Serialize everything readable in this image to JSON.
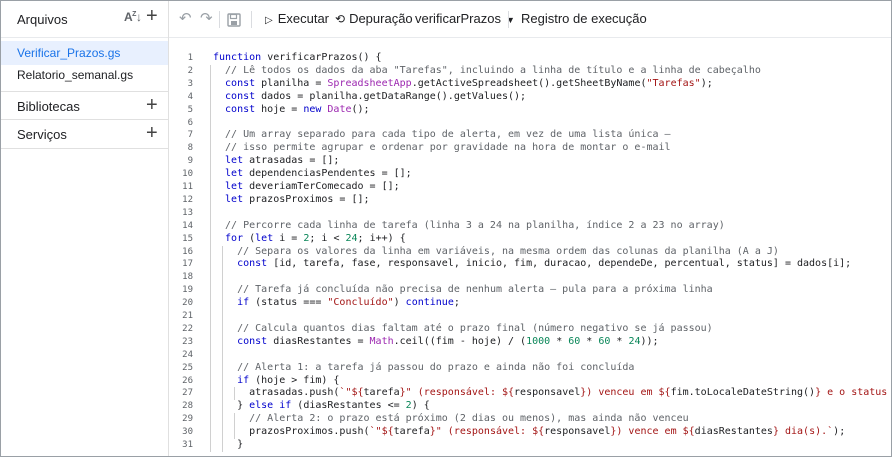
{
  "sidebar": {
    "title": "Arquivos",
    "sort_icon": "az-sort-icon",
    "files": [
      "Verificar_Prazos.gs",
      "Relatorio_semanal.gs"
    ],
    "active_file": "Verificar_Prazos.gs",
    "sections": [
      "Bibliotecas",
      "Serviços"
    ]
  },
  "toolbar": {
    "run_label": "Executar",
    "debug_label": "Depuração",
    "function_select": "verificarPrazos",
    "log_label": "Registro de execução"
  },
  "colors": {
    "keyword": "#0000cc",
    "comment": "#5f6368",
    "string": "#a31515",
    "function": "#9c27b0",
    "number": "#098658",
    "active_file_bg": "#e8f0fe",
    "active_file_text": "#1a73e8"
  },
  "code": {
    "lines": [
      {
        "n": "1",
        "indent": 0,
        "tokens": [
          [
            "k",
            "function "
          ],
          [
            "p",
            "verificarPrazos() {"
          ]
        ]
      },
      {
        "n": "2",
        "indent": 1,
        "tokens": [
          [
            "c",
            "// Lê todos os dados da aba \"Tarefas\", incluindo a linha de título e a linha de cabeçalho"
          ]
        ]
      },
      {
        "n": "3",
        "indent": 1,
        "tokens": [
          [
            "k",
            "const "
          ],
          [
            "p",
            "planilha = "
          ],
          [
            "f",
            "SpreadsheetApp"
          ],
          [
            "p",
            ".getActiveSpreadsheet().getSheetByName("
          ],
          [
            "s",
            "\"Tarefas\""
          ],
          [
            "p",
            ");"
          ]
        ]
      },
      {
        "n": "4",
        "indent": 1,
        "tokens": [
          [
            "k",
            "const "
          ],
          [
            "p",
            "dados = planilha.getDataRange().getValues();"
          ]
        ]
      },
      {
        "n": "5",
        "indent": 1,
        "tokens": [
          [
            "k",
            "const "
          ],
          [
            "p",
            "hoje = "
          ],
          [
            "k",
            "new "
          ],
          [
            "f",
            "Date"
          ],
          [
            "p",
            "();"
          ]
        ]
      },
      {
        "n": "6",
        "indent": 0,
        "tokens": []
      },
      {
        "n": "7",
        "indent": 1,
        "tokens": [
          [
            "c",
            "// Um array separado para cada tipo de alerta, em vez de uma lista única —"
          ]
        ]
      },
      {
        "n": "8",
        "indent": 1,
        "tokens": [
          [
            "c",
            "// isso permite agrupar e ordenar por gravidade na hora de montar o e-mail"
          ]
        ]
      },
      {
        "n": "9",
        "indent": 1,
        "tokens": [
          [
            "k",
            "let "
          ],
          [
            "p",
            "atrasadas = [];"
          ]
        ]
      },
      {
        "n": "10",
        "indent": 1,
        "tokens": [
          [
            "k",
            "let "
          ],
          [
            "p",
            "dependenciasPendentes = [];"
          ]
        ]
      },
      {
        "n": "11",
        "indent": 1,
        "tokens": [
          [
            "k",
            "let "
          ],
          [
            "p",
            "deveriamTerComecado = [];"
          ]
        ]
      },
      {
        "n": "12",
        "indent": 1,
        "tokens": [
          [
            "k",
            "let "
          ],
          [
            "p",
            "prazosProximos = [];"
          ]
        ]
      },
      {
        "n": "13",
        "indent": 0,
        "tokens": []
      },
      {
        "n": "14",
        "indent": 1,
        "tokens": [
          [
            "c",
            "// Percorre cada linha de tarefa (linha 3 a 24 na planilha, índice 2 a 23 no array)"
          ]
        ]
      },
      {
        "n": "15",
        "indent": 1,
        "tokens": [
          [
            "k",
            "for "
          ],
          [
            "p",
            "("
          ],
          [
            "k",
            "let "
          ],
          [
            "p",
            "i = "
          ],
          [
            "n",
            "2"
          ],
          [
            "p",
            "; i < "
          ],
          [
            "n",
            "24"
          ],
          [
            "p",
            "; i++) {"
          ]
        ]
      },
      {
        "n": "16",
        "indent": 2,
        "tokens": [
          [
            "c",
            "// Separa os valores da linha em variáveis, na mesma ordem das colunas da planilha (A a J)"
          ]
        ]
      },
      {
        "n": "17",
        "indent": 2,
        "tokens": [
          [
            "k",
            "const "
          ],
          [
            "p",
            "[id, tarefa, fase, responsavel, inicio, fim, duracao, dependeDe, percentual, status] = dados[i];"
          ]
        ]
      },
      {
        "n": "18",
        "indent": 0,
        "tokens": []
      },
      {
        "n": "19",
        "indent": 2,
        "tokens": [
          [
            "c",
            "// Tarefa já concluída não precisa de nenhum alerta — pula para a próxima linha"
          ]
        ]
      },
      {
        "n": "20",
        "indent": 2,
        "tokens": [
          [
            "k",
            "if "
          ],
          [
            "p",
            "(status === "
          ],
          [
            "s",
            "\"Concluído\""
          ],
          [
            "p",
            ") "
          ],
          [
            "k",
            "continue"
          ],
          [
            "p",
            ";"
          ]
        ]
      },
      {
        "n": "21",
        "indent": 0,
        "tokens": []
      },
      {
        "n": "22",
        "indent": 2,
        "tokens": [
          [
            "c",
            "// Calcula quantos dias faltam até o prazo final (número negativo se já passou)"
          ]
        ]
      },
      {
        "n": "23",
        "indent": 2,
        "tokens": [
          [
            "k",
            "const "
          ],
          [
            "p",
            "diasRestantes = "
          ],
          [
            "f",
            "Math"
          ],
          [
            "p",
            ".ceil((fim - hoje) / ("
          ],
          [
            "n",
            "1000"
          ],
          [
            "p",
            " * "
          ],
          [
            "n",
            "60"
          ],
          [
            "p",
            " * "
          ],
          [
            "n",
            "60"
          ],
          [
            "p",
            " * "
          ],
          [
            "n",
            "24"
          ],
          [
            "p",
            "));"
          ]
        ]
      },
      {
        "n": "24",
        "indent": 0,
        "tokens": []
      },
      {
        "n": "25",
        "indent": 2,
        "tokens": [
          [
            "c",
            "// Alerta 1: a tarefa já passou do prazo e ainda não foi concluída"
          ]
        ]
      },
      {
        "n": "26",
        "indent": 2,
        "tokens": [
          [
            "k",
            "if "
          ],
          [
            "p",
            "(hoje > fim) {"
          ]
        ]
      },
      {
        "n": "27",
        "indent": 3,
        "tokens": [
          [
            "p",
            "atrasadas.push("
          ],
          [
            "s",
            "`\"${"
          ],
          [
            "p",
            "tarefa"
          ],
          [
            "s",
            "}\" (responsável: ${"
          ],
          [
            "p",
            "responsavel"
          ],
          [
            "s",
            "}) venceu em ${"
          ],
          [
            "p",
            "fim.toLocaleDateString()"
          ],
          [
            "s",
            "} e o status ainda é"
          ]
        ]
      },
      {
        "n": "28",
        "indent": 2,
        "tokens": [
          [
            "p",
            "} "
          ],
          [
            "k",
            "else if "
          ],
          [
            "p",
            "(diasRestantes <= "
          ],
          [
            "n",
            "2"
          ],
          [
            "p",
            ") {"
          ]
        ]
      },
      {
        "n": "29",
        "indent": 3,
        "tokens": [
          [
            "c",
            "// Alerta 2: o prazo está próximo (2 dias ou menos), mas ainda não venceu"
          ]
        ]
      },
      {
        "n": "30",
        "indent": 3,
        "tokens": [
          [
            "p",
            "prazosProximos.push("
          ],
          [
            "s",
            "`\"${"
          ],
          [
            "p",
            "tarefa"
          ],
          [
            "s",
            "}\" (responsável: ${"
          ],
          [
            "p",
            "responsavel"
          ],
          [
            "s",
            "}) vence em ${"
          ],
          [
            "p",
            "diasRestantes"
          ],
          [
            "s",
            "} dia(s).`"
          ],
          [
            "p",
            ");"
          ]
        ]
      },
      {
        "n": "31",
        "indent": 2,
        "tokens": [
          [
            "p",
            "}"
          ]
        ]
      }
    ]
  }
}
